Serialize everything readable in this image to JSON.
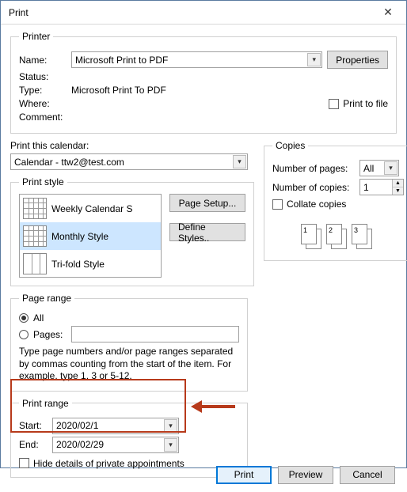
{
  "window": {
    "title": "Print"
  },
  "printer": {
    "legend": "Printer",
    "name_label": "Name:",
    "name_value": "Microsoft Print to PDF",
    "properties_btn": "Properties",
    "status_label": "Status:",
    "type_label": "Type:",
    "type_value": "Microsoft Print To PDF",
    "where_label": "Where:",
    "comment_label": "Comment:",
    "print_to_file": "Print to file"
  },
  "print_calendar": {
    "label": "Print this calendar:",
    "value": "Calendar - ttw2@test.com"
  },
  "print_style": {
    "legend": "Print style",
    "items": [
      "Weekly Calendar S",
      "Monthly Style",
      "Tri-fold Style"
    ],
    "page_setup_btn": "Page Setup...",
    "define_styles_btn": "Define Styles.."
  },
  "copies": {
    "legend": "Copies",
    "pages_label": "Number of pages:",
    "pages_value": "All",
    "copies_label": "Number of copies:",
    "copies_value": "1",
    "collate_label": "Collate copies",
    "stack_nums": [
      "1",
      "2",
      "3"
    ]
  },
  "page_range": {
    "legend": "Page range",
    "all_label": "All",
    "pages_label": "Pages:",
    "help_text": "Type page numbers and/or page ranges separated by commas counting from the start of the item.  For example, type 1, 3 or 5-12."
  },
  "print_range": {
    "legend": "Print range",
    "start_label": "Start:",
    "start_value": "2020/02/1",
    "end_label": "End:",
    "end_value": "2020/02/29",
    "hide_private": "Hide details of private appointments"
  },
  "footer": {
    "print_btn": "Print",
    "preview_btn": "Preview",
    "cancel_btn": "Cancel"
  }
}
